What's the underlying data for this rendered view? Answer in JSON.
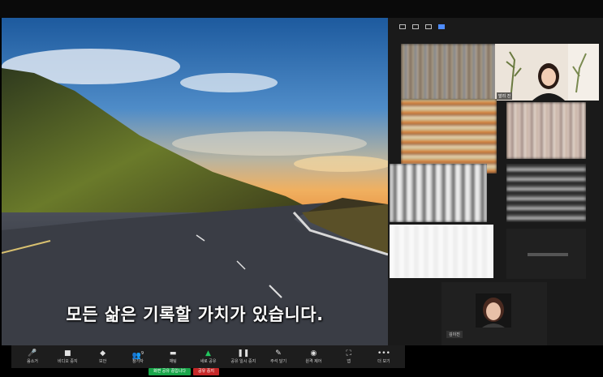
{
  "caption": "모든 삶은 기록할 가치가 있습니다.",
  "gallery": {
    "tiles": [
      {
        "name": "",
        "colors": [
          "#8a7a6a",
          "#b8a890",
          "#4a5a7a",
          "#d0c0a8"
        ]
      },
      {
        "name": "말리 진",
        "colors": [
          "#e8e0d6"
        ]
      },
      {
        "name": "",
        "colors": [
          "#c8b890",
          "#e08030",
          "#906850",
          "#f0d8b0"
        ]
      },
      {
        "name": "",
        "colors": [
          "#c0a898",
          "#e0d0c8",
          "#907870",
          "#f0e8e0"
        ]
      },
      {
        "name": "",
        "colors": [
          "#d8d8d8",
          "#a0a0a0",
          "#505050",
          "#f0f0f0"
        ]
      },
      {
        "name": "",
        "colors": [
          "#606060",
          "#383838",
          "#d0d0d0",
          "#202020"
        ]
      },
      {
        "name": "",
        "colors": [
          "#f5f5f5",
          "#ffffff"
        ]
      },
      {
        "name": "",
        "colors": [
          "#2a2a2a"
        ]
      }
    ],
    "self_view_name": "김이진"
  },
  "toolbar": {
    "items": [
      {
        "icon": "mic-icon",
        "glyph": "🎤",
        "label": "음소거"
      },
      {
        "icon": "video-icon",
        "glyph": "■",
        "label": "비디오 중지"
      },
      {
        "icon": "shield-icon",
        "glyph": "◆",
        "label": "보안"
      },
      {
        "icon": "participants-icon",
        "glyph": "👥",
        "label": "참가자",
        "count": "9"
      },
      {
        "icon": "chat-icon",
        "glyph": "▬",
        "label": "채팅"
      },
      {
        "icon": "share-icon",
        "glyph": "▲",
        "label": "새로 공유"
      },
      {
        "icon": "pause-icon",
        "glyph": "❚❚",
        "label": "공유 일시 중지"
      },
      {
        "icon": "annotate-icon",
        "glyph": "✎",
        "label": "주석 달기"
      },
      {
        "icon": "remote-control-icon",
        "glyph": "◉",
        "label": "원격 제어"
      },
      {
        "icon": "apps-icon",
        "glyph": "⛶",
        "label": "앱"
      },
      {
        "icon": "more-icon",
        "glyph": "•••",
        "label": "더 보기"
      }
    ]
  },
  "share_bar": {
    "status": "화면 공유 중입니다",
    "stop": "공유 중지"
  },
  "colors": {
    "share_green": "#19a64a",
    "stop_red": "#c62828",
    "accent_blue": "#4e8cff"
  }
}
